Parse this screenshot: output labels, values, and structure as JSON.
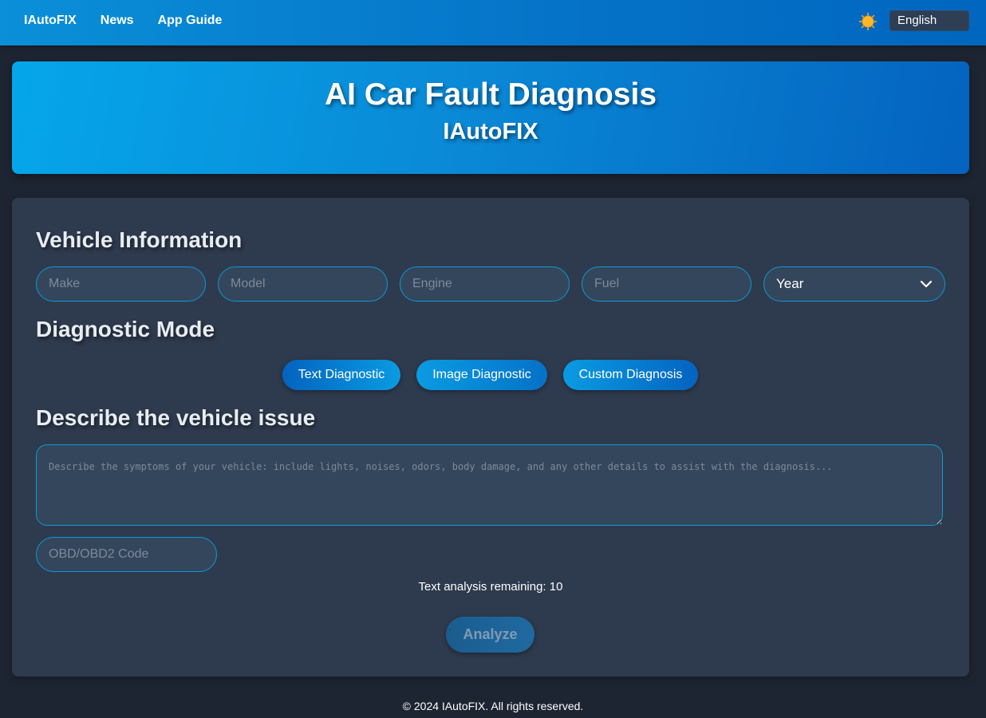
{
  "nav": {
    "links": [
      "IAutoFIX",
      "News",
      "App Guide"
    ],
    "theme_icon": "sun-icon",
    "language": "English"
  },
  "hero": {
    "title": "AI Car Fault Diagnosis",
    "subtitle": "IAutoFIX"
  },
  "vehicle_info": {
    "heading": "Vehicle Information",
    "make_placeholder": "Make",
    "model_placeholder": "Model",
    "engine_placeholder": "Engine",
    "fuel_placeholder": "Fuel",
    "year_selected": "Year",
    "year_icon": "chevron-down-icon"
  },
  "diagnostic_mode": {
    "heading": "Diagnostic Mode",
    "buttons": [
      "Text Diagnostic",
      "Image Diagnostic",
      "Custom Diagnosis"
    ]
  },
  "issue": {
    "heading": "Describe the vehicle issue",
    "textarea_placeholder": "Describe the symptoms of your vehicle: include lights, noises, odors, body damage, and any other details to assist with the diagnosis...",
    "obd_placeholder": "OBD/OBD2 Code",
    "remaining": "Text analysis remaining: 10",
    "analyze_label": "Analyze"
  },
  "footer": {
    "text": "© 2024 IAutoFIX. All rights reserved."
  },
  "colors": {
    "accent": "#0b9ad8",
    "background": "#1e2532",
    "card": "#2e3a4d",
    "input": "#34465c"
  }
}
